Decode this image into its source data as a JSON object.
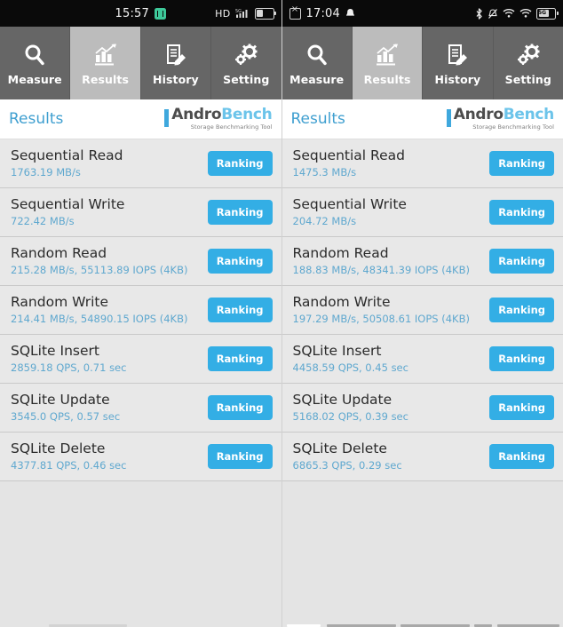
{
  "app": {
    "name": "AndroBench",
    "logo_primary": "Andro",
    "logo_secondary": "Bench",
    "logo_tagline": "Storage Benchmarking Tool",
    "accent_color": "#33aee5",
    "title_color": "#3f9fd0",
    "active_tab_color": "#bcbcbc",
    "tab_color": "#666666"
  },
  "tabs": [
    {
      "label": "Measure",
      "icon": "magnifier-icon",
      "active": false
    },
    {
      "label": "Results",
      "icon": "bar-chart-icon",
      "active": true
    },
    {
      "label": "History",
      "icon": "document-pen-icon",
      "active": false
    },
    {
      "label": "Setting",
      "icon": "gears-icon",
      "active": false
    }
  ],
  "header": {
    "title": "Results"
  },
  "ranking_label": "Ranking",
  "phones": [
    {
      "id": "left",
      "statusbar": {
        "time": "15:57",
        "badge_icon": "app-badge-icon",
        "network_label": "HD",
        "signal_icon": "signal-5g-icon",
        "battery_icon": "battery-icon"
      },
      "results": [
        {
          "title": "Sequential Read",
          "value": "1763.19 MB/s"
        },
        {
          "title": "Sequential Write",
          "value": "722.42 MB/s"
        },
        {
          "title": "Random Read",
          "value": "215.28 MB/s, 55113.89 IOPS (4KB)"
        },
        {
          "title": "Random Write",
          "value": "214.41 MB/s, 54890.15 IOPS (4KB)"
        },
        {
          "title": "SQLite Insert",
          "value": "2859.18 QPS, 0.71 sec"
        },
        {
          "title": "SQLite Update",
          "value": "3545.0 QPS, 0.57 sec"
        },
        {
          "title": "SQLite Delete",
          "value": "4377.81 QPS, 0.46 sec"
        }
      ]
    },
    {
      "id": "right",
      "statusbar": {
        "time": "17:04",
        "badge_icon": "no-sim-icon",
        "bell_icon": "notification-bell-icon",
        "bluetooth_icon": "bluetooth-icon",
        "mute_icon": "bell-muted-icon",
        "wifi_icon": "wifi-icon",
        "wifi2_icon": "wifi-icon",
        "battery_icon": "battery-5g-icon",
        "battery_label": "5G"
      },
      "results": [
        {
          "title": "Sequential Read",
          "value": "1475.3 MB/s"
        },
        {
          "title": "Sequential Write",
          "value": "204.72 MB/s"
        },
        {
          "title": "Random Read",
          "value": "188.83 MB/s, 48341.39 IOPS (4KB)"
        },
        {
          "title": "Random Write",
          "value": "197.29 MB/s, 50508.61 IOPS (4KB)"
        },
        {
          "title": "SQLite Insert",
          "value": "4458.59 QPS, 0.45 sec"
        },
        {
          "title": "SQLite Update",
          "value": "5168.02 QPS, 0.39 sec"
        },
        {
          "title": "SQLite Delete",
          "value": "6865.3 QPS, 0.29 sec"
        }
      ]
    }
  ]
}
